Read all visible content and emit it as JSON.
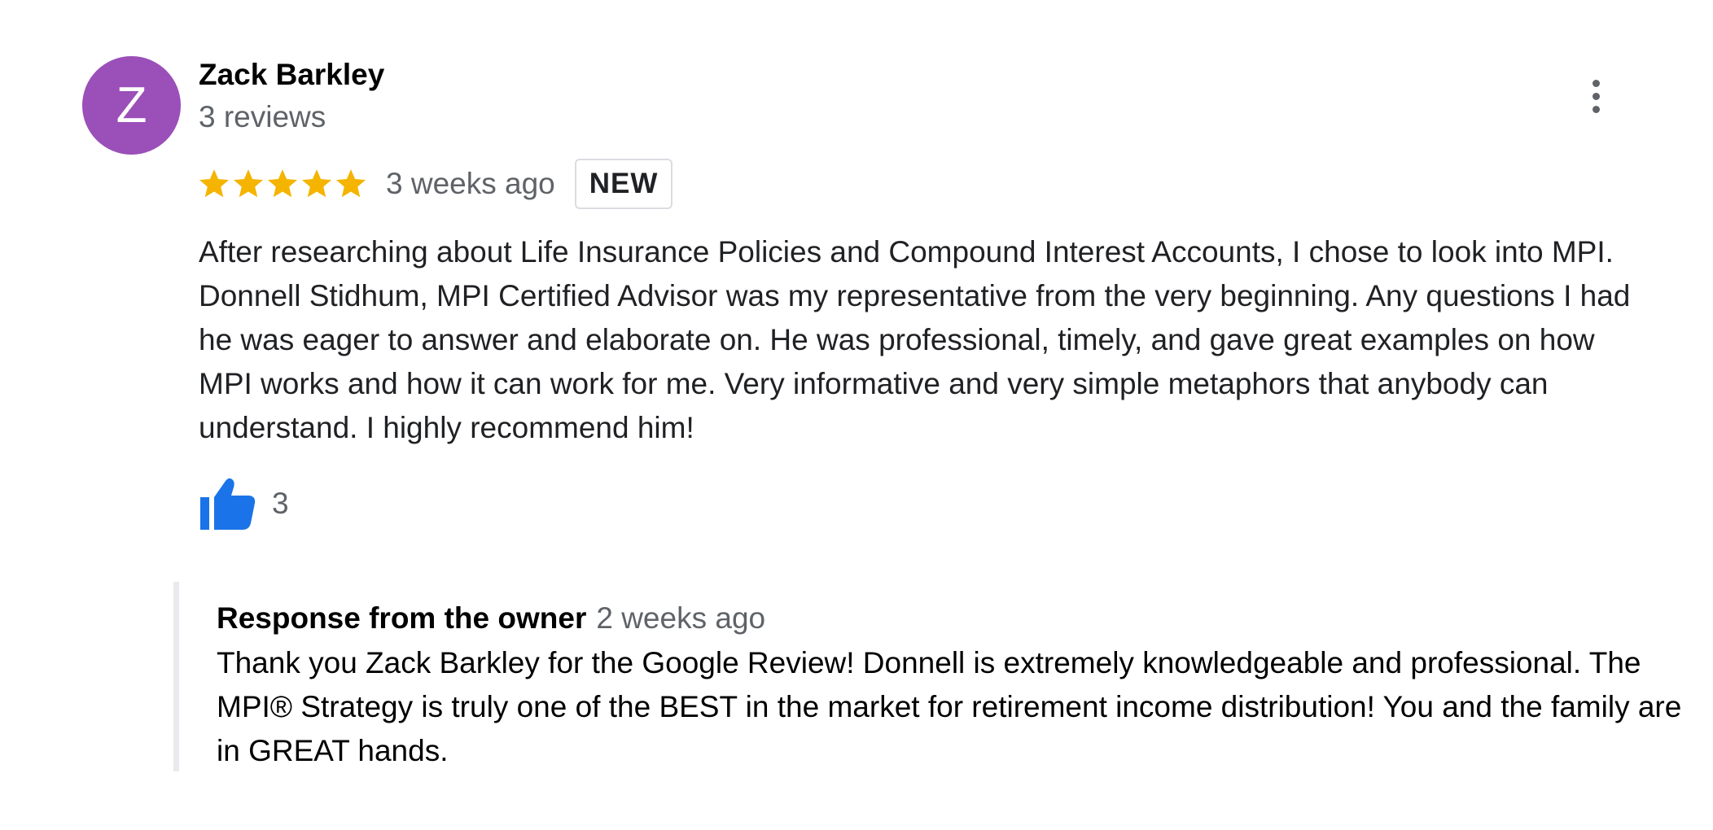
{
  "reviewer": {
    "initial": "Z",
    "name": "Zack Barkley",
    "review_count": "3 reviews",
    "avatar_color": "#9b4fb8"
  },
  "menu": {
    "icon": "more-vert-icon"
  },
  "review": {
    "rating": 5,
    "rating_max": 5,
    "star_color": "#f4b400",
    "date": "3 weeks ago",
    "badge": "NEW",
    "text": "After researching about Life Insurance Policies and Compound Interest Accounts, I chose to look into MPI.  Donnell Stidhum, MPI Certified Advisor was my representative from the very beginning. Any questions I had he was eager to answer and elaborate on. He was professional, timely, and gave great examples on how MPI works and how it can work for me. Very informative and very simple metaphors that anybody can understand. I highly recommend him!",
    "likes": "3",
    "like_icon": "thumbs-up-icon",
    "like_color": "#1a73e8"
  },
  "owner_response": {
    "title": "Response from the owner",
    "date": "2 weeks ago",
    "text": "Thank you Zack Barkley for the Google Review! Donnell is extremely knowledgeable and professional. The MPI® Strategy is truly one of the BEST in the market for retirement income distribution! You and the family are in GREAT hands."
  }
}
